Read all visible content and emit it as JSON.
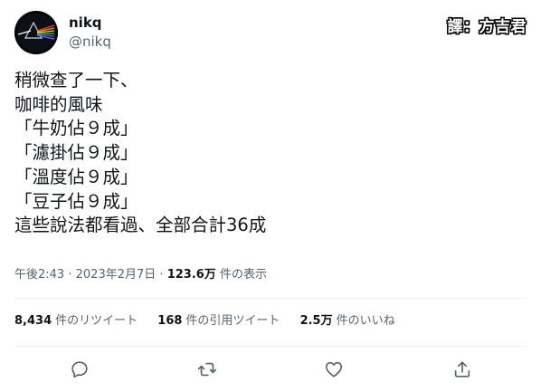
{
  "author": {
    "display_name": "nikq",
    "handle": "@nikq"
  },
  "translator_tag": "譯：方吉君",
  "tweet": {
    "lines": [
      "稍微查了一下、",
      "咖啡的風味",
      "「牛奶佔９成」",
      "「濾掛佔９成」",
      "「溫度佔９成」",
      "「豆子佔９成」",
      "這些說法都看過、全部合計36成"
    ]
  },
  "meta": {
    "time": "午後2:43",
    "separator1": "·",
    "date": "2023年2月7日",
    "separator2": "·",
    "views_count": "123.6万",
    "views_label": "件の表示"
  },
  "stats": {
    "retweets": {
      "count": "8,434",
      "label": "件のリツイート"
    },
    "quotes": {
      "count": "168",
      "label": "件の引用ツイート"
    },
    "likes": {
      "count": "2.5万",
      "label": "件のいいね"
    }
  },
  "actions": {
    "reply_icon": "reply-icon",
    "retweet_icon": "retweet-icon",
    "like_icon": "heart-icon",
    "share_icon": "share-icon"
  },
  "colors": {
    "text": "#0f1419",
    "secondary": "#536471",
    "divider": "#eff3f4",
    "background": "#ffffff"
  }
}
